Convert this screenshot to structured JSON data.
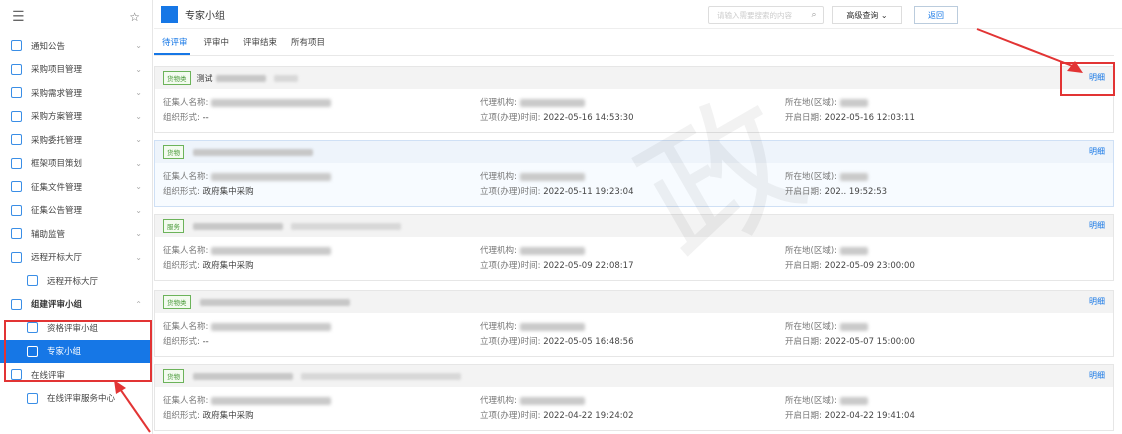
{
  "sidebar": {
    "pin_icon": "pin-icon",
    "items": [
      {
        "label": "通知公告"
      },
      {
        "label": "采购项目管理"
      },
      {
        "label": "采购需求管理"
      },
      {
        "label": "采购方案管理"
      },
      {
        "label": "采购委托管理"
      },
      {
        "label": "框架项目策划"
      },
      {
        "label": "征集文件管理"
      },
      {
        "label": "征集公告管理"
      },
      {
        "label": "辅助监管"
      },
      {
        "label": "远程开标大厅"
      },
      {
        "label": "远程开标大厅"
      },
      {
        "label": "组建评审小组"
      },
      {
        "label": "资格评审小组"
      },
      {
        "label": "专家小组"
      },
      {
        "label": "在线评审"
      },
      {
        "label": "在线评审服务中心"
      }
    ]
  },
  "header": {
    "title": "专家小组",
    "search_placeholder": "请输入需要搜索的内容",
    "advanced_search": "高级查询",
    "back": "返回"
  },
  "tabs": [
    "待评审",
    "评审中",
    "评审结束",
    "所有项目"
  ],
  "labels": {
    "collector": "征集人名称:",
    "org_form": "组织形式:",
    "agency": "代理机构:",
    "setup_time": "立项(办理)时间:",
    "region": "所在地(区域):",
    "open_date": "开启日期:",
    "detail": "明细"
  },
  "cards": [
    {
      "tag": "货物类",
      "title_prefix": "测试",
      "org_form": "--",
      "setup_time": "2022-05-16 14:53:30",
      "open_date": "2022-05-16 12:03:11"
    },
    {
      "tag": "货物",
      "title_prefix": "",
      "org_form": "政府集中采购",
      "setup_time": "2022-05-11 19:23:04",
      "open_date": "202.. 19:52:53"
    },
    {
      "tag": "服务",
      "title_prefix": "",
      "org_form": "政府集中采购",
      "setup_time": "2022-05-09 22:08:17",
      "open_date": "2022-05-09 23:00:00"
    },
    {
      "tag": "货物类",
      "title_prefix": "",
      "org_form": "--",
      "setup_time": "2022-05-05 16:48:56",
      "open_date": "2022-05-07 15:00:00"
    },
    {
      "tag": "货物",
      "title_prefix": "",
      "org_form": "政府集中采购",
      "setup_time": "2022-04-22 19:24:02",
      "open_date": "2022-04-22 19:41:04"
    }
  ],
  "colors": {
    "accent": "#1677e6",
    "annotation": "#e23434"
  }
}
